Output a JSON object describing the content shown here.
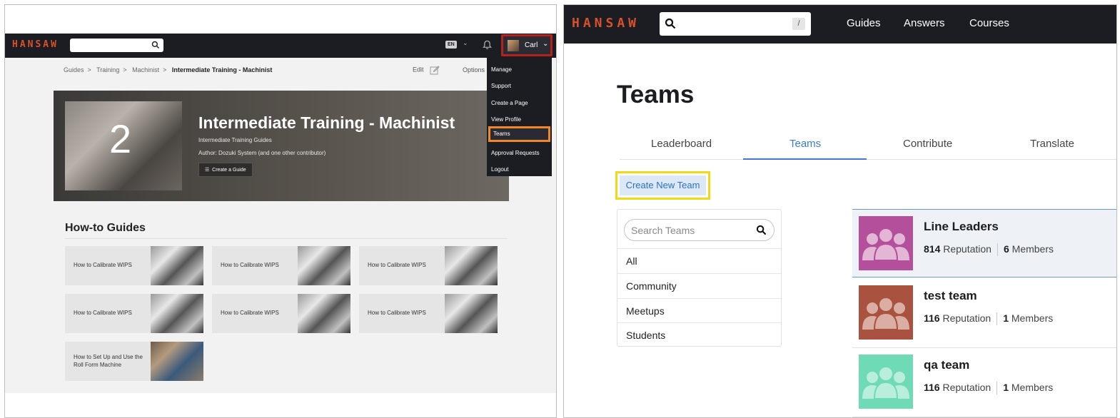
{
  "left": {
    "logo": "HANSAW",
    "lang": "EN",
    "user_name": "Carl",
    "breadcrumb": [
      "Guides",
      "Training",
      "Machinist",
      "Intermediate Training - Machinist"
    ],
    "edit_label": "Edit",
    "options_label": "Options",
    "hero": {
      "number": "2",
      "title": "Intermediate Training - Machinist",
      "subtitle": "Intermediate Training Guides",
      "author": "Author: Dozuki System (and one other contributor)",
      "create_guide": "Create a Guide"
    },
    "howto_title": "How-to Guides",
    "guides": [
      "How to Calibrate WIPS",
      "How to Calibrate WIPS",
      "How to Calibrate WIPS",
      "How to Calibrate WIPS",
      "How to Calibrate WIPS",
      "How to Calibrate WIPS",
      "How to Set Up and Use the Roll Form Machine"
    ],
    "menu": [
      "Manage",
      "Support",
      "Create a Page",
      "View Profile",
      "Teams",
      "Approval Requests",
      "Logout"
    ],
    "colors": {
      "brand": "#d9502a",
      "highlight_user": "#b3231d",
      "highlight_teams": "#f0882a"
    }
  },
  "right": {
    "logo": "HANSAW",
    "search_shortcut": "/",
    "nav": [
      "Guides",
      "Answers",
      "Courses"
    ],
    "title": "Teams",
    "tabs": [
      "Leaderboard",
      "Teams",
      "Contribute",
      "Translate"
    ],
    "active_tab": "Teams",
    "create_team": "Create New Team",
    "search_placeholder": "Search Teams",
    "filters": [
      "All",
      "Community",
      "Meetups",
      "Students"
    ],
    "teams": [
      {
        "name": "Line Leaders",
        "reputation": "814",
        "reputation_label": "Reputation",
        "members": "6",
        "members_label": "Members",
        "color": "#b44f9c"
      },
      {
        "name": "test team",
        "reputation": "116",
        "reputation_label": "Reputation",
        "members": "1",
        "members_label": "Members",
        "color": "#a8523f"
      },
      {
        "name": "qa team",
        "reputation": "116",
        "reputation_label": "Reputation",
        "members": "1",
        "members_label": "Members",
        "color": "#6fdbb6"
      }
    ],
    "colors": {
      "accent": "#3b7bd4",
      "highlight_create": "#f0d916"
    }
  }
}
